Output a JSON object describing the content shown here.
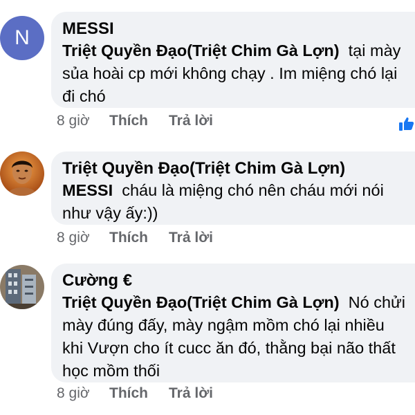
{
  "comments": [
    {
      "avatar_letter": "N",
      "author": "MESSI",
      "mention": "Triệt Quyền Đạo(Triệt Chim Gà Lợn)",
      "text": "tại mày sủa hoài cp mới không chạy . Im miệng chó lại đi chó",
      "time": "8 giờ",
      "like_label": "Thích",
      "reply_label": "Trả lời",
      "reaction_icon": "thumbs-up-icon"
    },
    {
      "avatar_icon": "user-photo-avatar",
      "author": "Triệt Quyền Đạo(Triệt Chim Gà Lợn)",
      "mention": "MESSI",
      "text": "cháu là miệng chó nên cháu mới nói như vậy ấy:))",
      "time": "8 giờ",
      "like_label": "Thích",
      "reply_label": "Trả lời"
    },
    {
      "avatar_icon": "building-photo-avatar",
      "author": "Cường €",
      "mention": "Triệt Quyền Đạo(Triệt Chim Gà Lợn)",
      "text": "Nó chửi mày đúng đấy, mày ngậm mồm chó lại nhiều khi Vượn cho ít cucc ăn đó, thằng bại não thất học mồm thối",
      "time": "8 giờ",
      "like_label": "Thích",
      "reply_label": "Trả lời"
    }
  ],
  "colors": {
    "bubble": "#f0f2f5",
    "avatar_letter_bg": "#5b6ec4",
    "meta_text": "#65676b",
    "like_blue": "#1877f2"
  }
}
